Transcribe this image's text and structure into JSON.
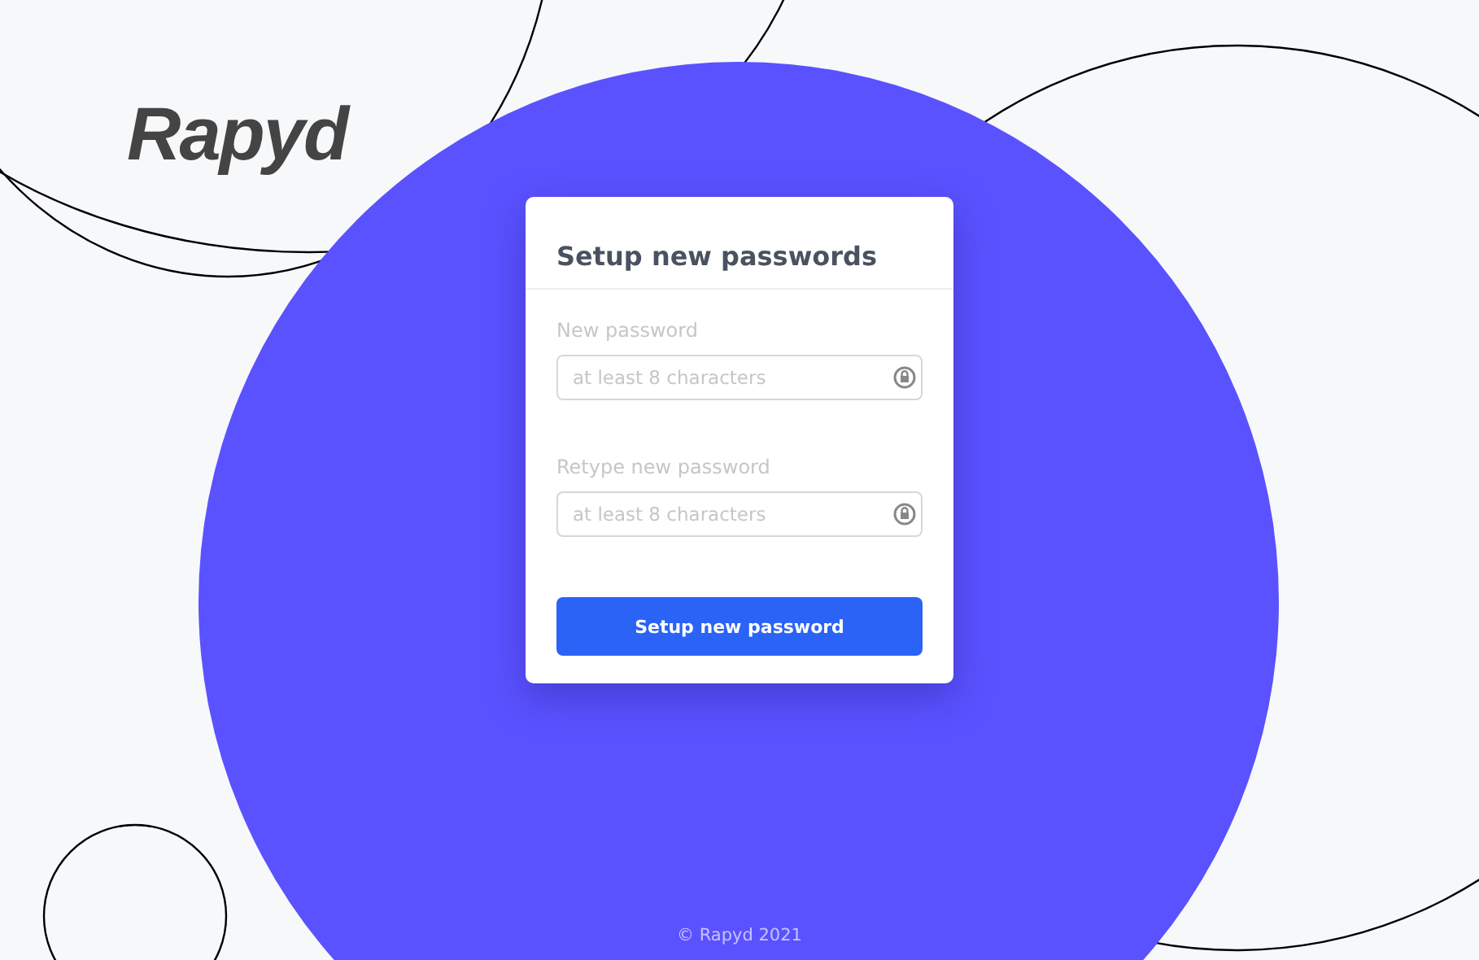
{
  "logo": {
    "text": "Rapyd"
  },
  "card": {
    "title": "Setup new passwords",
    "fields": [
      {
        "label": "New password",
        "placeholder": "at least 8 characters"
      },
      {
        "label": "Retype new password",
        "placeholder": "at least 8 characters"
      }
    ],
    "button": "Setup new password"
  },
  "footer": "© Rapyd 2021"
}
